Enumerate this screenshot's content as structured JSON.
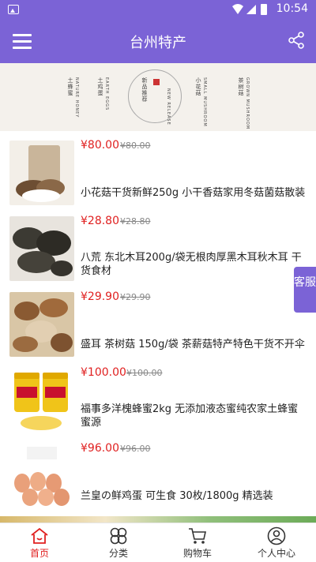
{
  "status": {
    "time": "10:54"
  },
  "header": {
    "title": "台州特产"
  },
  "banner": {
    "labels": [
      "土蜂蜜",
      "土鸡蛋",
      "新品推荐",
      "小花菇",
      "茶树菇"
    ],
    "sub_labels": [
      "NATURE HONEY",
      "EARTH EGGS",
      "NEW RELEASE",
      "SMALL MUSHROOM",
      "GROWN MUSHROOM"
    ]
  },
  "products": [
    {
      "price": "¥80.00",
      "old_price": "¥80.00",
      "name": "小花菇干货新鲜250g 小干香菇家用冬菇菌菇散装"
    },
    {
      "price": "¥28.80",
      "old_price": "¥28.80",
      "name": "八荒 东北木耳200g/袋无根肉厚黑木耳秋木耳 干货食材"
    },
    {
      "price": "¥29.90",
      "old_price": "¥29.90",
      "name": "盛耳 茶树菇 150g/袋 茶薪菇特产特色干货不开伞"
    },
    {
      "price": "¥100.00",
      "old_price": "¥100.00",
      "name": "福事多洋槐蜂蜜2kg 无添加液态蜜纯农家土蜂蜜 蜜源"
    },
    {
      "price": "¥96.00",
      "old_price": "¥96.00",
      "name": "兰皇の鲜鸡蛋 可生食 30枚/1800g 精选装"
    }
  ],
  "kefu": {
    "label": "客服"
  },
  "tabs": [
    {
      "label": "首页",
      "icon": "home-icon"
    },
    {
      "label": "分类",
      "icon": "category-icon"
    },
    {
      "label": "购物车",
      "icon": "cart-icon"
    },
    {
      "label": "个人中心",
      "icon": "user-icon"
    }
  ],
  "colors": {
    "accent": "#7b63d6",
    "price": "#e02020"
  }
}
